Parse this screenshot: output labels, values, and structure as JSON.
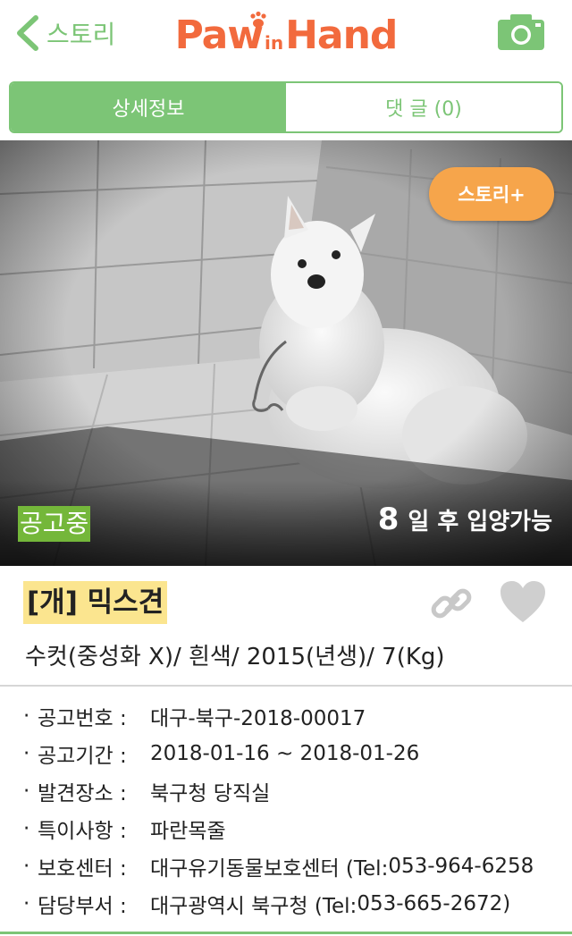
{
  "nav": {
    "back_label": "스토리",
    "logo": {
      "paw": "Paw",
      "in": "in",
      "hand": "Hand"
    },
    "camera_icon": "camera-icon"
  },
  "tabs": [
    {
      "label": "상세정보",
      "active": true
    },
    {
      "label": "댓 글 (0)",
      "active": false
    }
  ],
  "photo": {
    "story_button": "스토리+",
    "status": "공고중",
    "days": "8",
    "days_suffix": "일 후 입양가능"
  },
  "animal": {
    "title": "[개] 믹스견",
    "summary": "수컷(중성화 X)/ 흰색/ 2015(년생)/ 7(Kg)"
  },
  "details": [
    {
      "label": "공고번호 :",
      "value": "대구-북구-2018-00017"
    },
    {
      "label": "공고기간 :",
      "value": "2018-01-16 ~ 2018-01-26"
    },
    {
      "label": "발견장소 :",
      "value": "북구청 당직실"
    },
    {
      "label": "특이사항 :",
      "value": "파란목줄"
    },
    {
      "label": "보호센터 :",
      "value": "대구유기동물보호센터 (Tel: ",
      "tel": "053-964-6258",
      "tail": ""
    },
    {
      "label": "담당부서 :",
      "value": "대구광역시 북구청 (Tel: ",
      "tel": "053-665-2672",
      "tail": ")"
    }
  ],
  "colors": {
    "brand_green": "#7cc576",
    "logo_orange": "#f26a3d",
    "story_orange": "#f6a54b",
    "notice_number": "#e8722c",
    "phone_blue": "#3344cc",
    "title_highlight": "#fbe58f"
  }
}
